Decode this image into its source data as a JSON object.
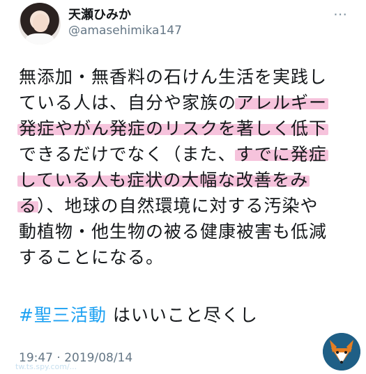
{
  "tweet": {
    "display_name": "天瀬ひみか",
    "handle": "@amasehimika147",
    "more_icon": "ellipsis-icon",
    "lines": [
      [
        {
          "text": "無添加・無香料の石けん生活を実践し",
          "hl": false
        }
      ],
      [
        {
          "text": "ている人は、自分や家族の",
          "hl": false
        },
        {
          "text": "アレルギー",
          "hl": true
        }
      ],
      [
        {
          "text": "発症やがん発症のリスクを著しく低下",
          "hl": true
        }
      ],
      [
        {
          "text": "できるだけでなく（また、",
          "hl": false
        },
        {
          "text": "すでに発症",
          "hl": true
        }
      ],
      [
        {
          "text": "している人も症状の大幅な改善をみ",
          "hl": true
        }
      ],
      [
        {
          "text": "る",
          "hl": true
        },
        {
          "text": "）、地球の自然環境に対する汚染や",
          "hl": false
        }
      ],
      [
        {
          "text": "動植物・他生物の被る健康被害も低減",
          "hl": false
        }
      ],
      [
        {
          "text": "することになる。",
          "hl": false
        }
      ]
    ],
    "hashtag": "#聖三活動",
    "comment": " はいいこと尽くし",
    "timestamp": "19:47 · 2019/08/14",
    "highlight_color": "#f4b4d3",
    "link_color": "#1da1f2",
    "secondary_color": "#657786"
  },
  "watermark": {
    "text": "tw.ts.spy.com/...",
    "logo": "fox-logo-icon"
  }
}
